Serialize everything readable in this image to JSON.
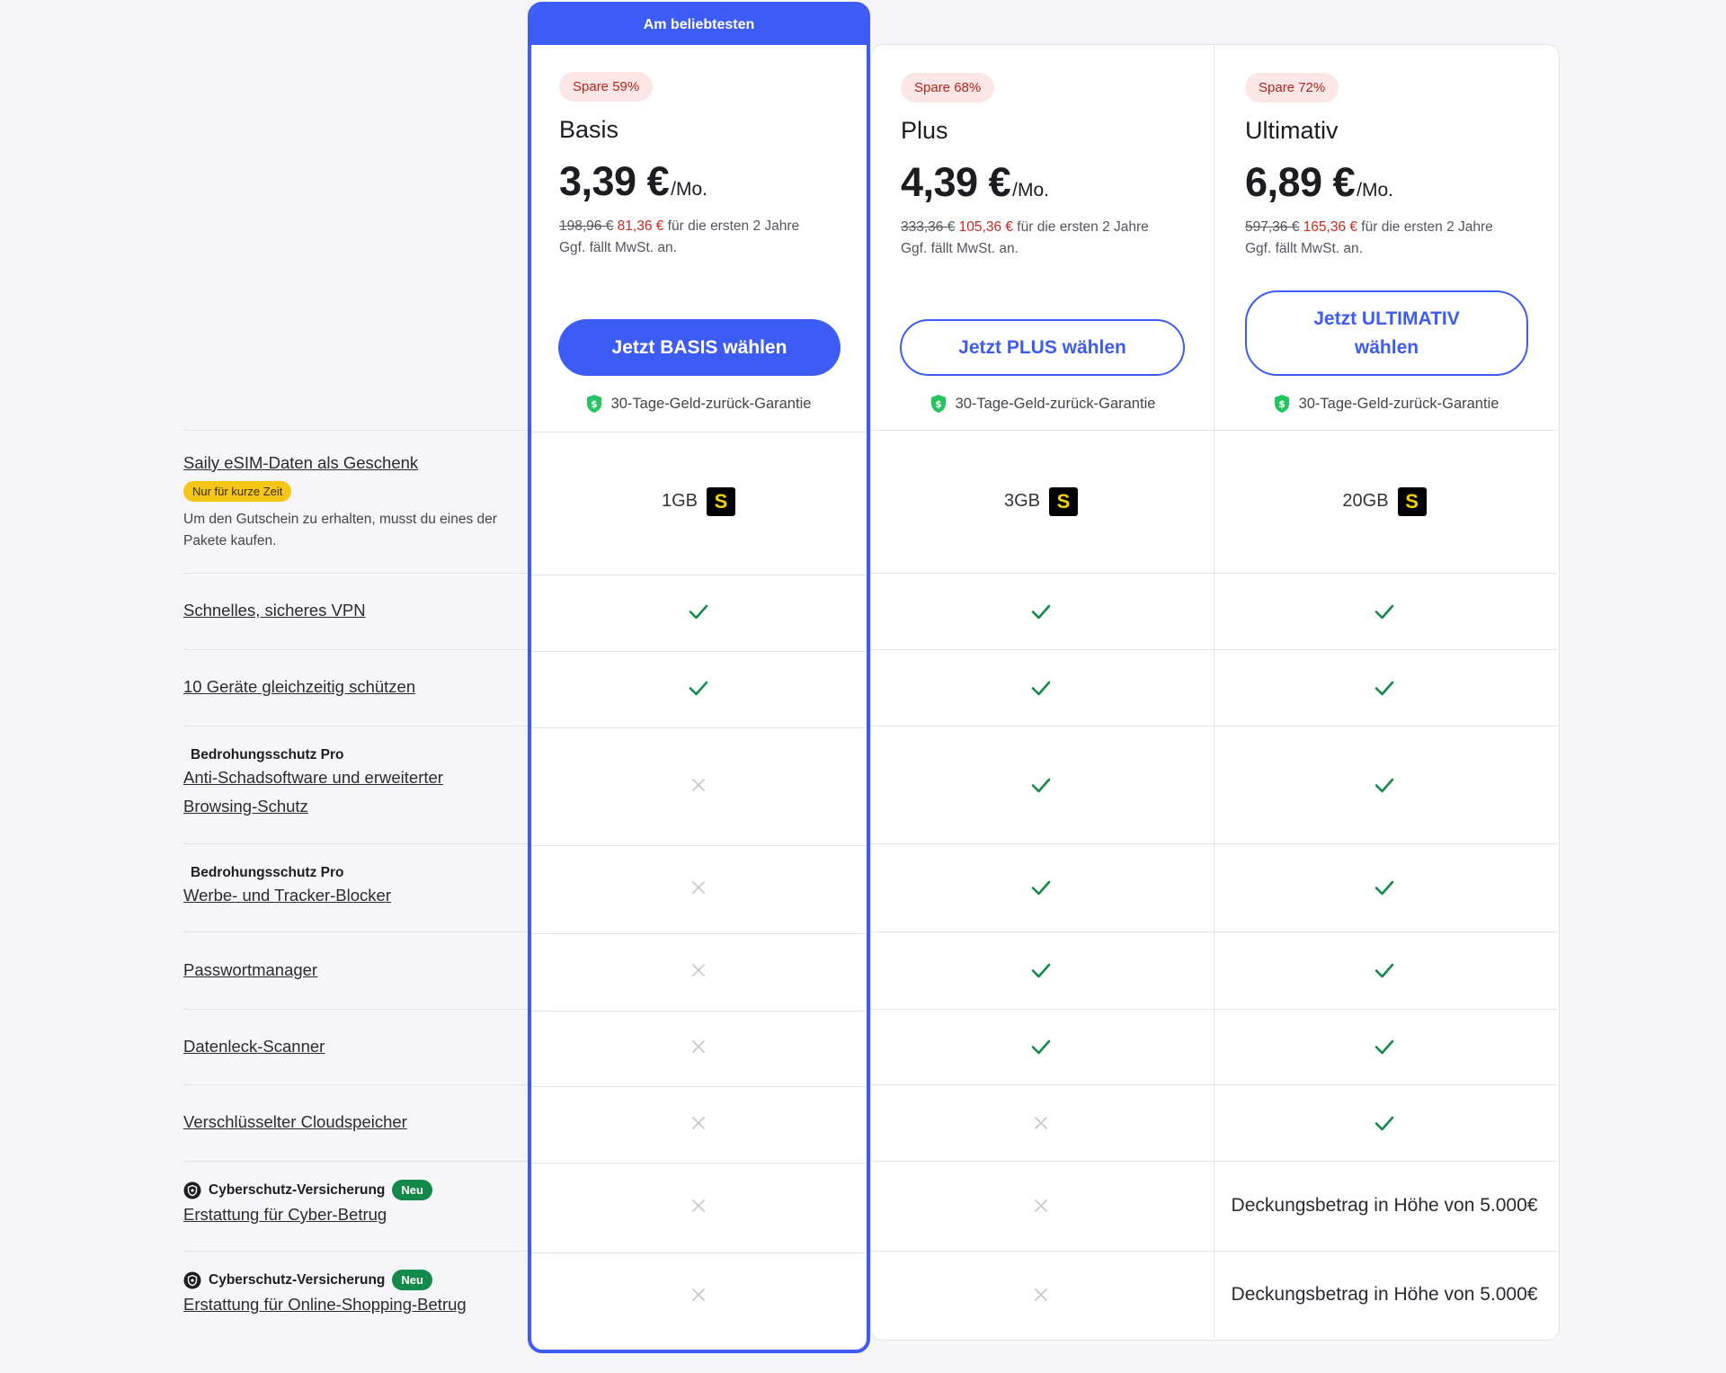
{
  "banner": "Am beliebtesten",
  "plans": [
    {
      "save": "Spare 59%",
      "name": "Basis",
      "price": "3,39 €",
      "unit": "/Mo.",
      "old": "198,96 €",
      "new": "81,36 €",
      "period": " für die ersten 2 Jahre",
      "vat": "Ggf. fällt MwSt. an.",
      "cta": "Jetzt BASIS wählen",
      "guarantee": "30-Tage-Geld-zurück-Garantie",
      "gb": "1GB"
    },
    {
      "save": "Spare 68%",
      "name": "Plus",
      "price": "4,39 €",
      "unit": "/Mo.",
      "old": "333,36 €",
      "new": "105,36 €",
      "period": " für die ersten 2 Jahre",
      "vat": "Ggf. fällt MwSt. an.",
      "cta": "Jetzt PLUS wählen",
      "guarantee": "30-Tage-Geld-zurück-Garantie",
      "gb": "3GB"
    },
    {
      "save": "Spare 72%",
      "name": "Ultimativ",
      "price": "6,89 €",
      "unit": "/Mo.",
      "old": "597,36 €",
      "new": "165,36 €",
      "period": " für die ersten 2 Jahre",
      "vat": "Ggf. fällt MwSt. an.",
      "cta": "Jetzt ULTIMATIV wählen",
      "guarantee": "30-Tage-Geld-zurück-Garantie",
      "gb": "20GB"
    }
  ],
  "saily_glyph": "S",
  "features": {
    "esim": {
      "title": "Saily eSIM-Daten als Geschenk",
      "tag": "Nur für kurze Zeit",
      "note": "Um den Gutschein zu erhalten, musst du eines der Pakete kaufen."
    },
    "vpn": "Schnelles, sicheres VPN",
    "devices": "10 Geräte gleichzeitig schützen",
    "antimalware": {
      "sub": "Bedrohungsschutz Pro",
      "title": "Anti-Schadsoftware und erweiterter Browsing-Schutz"
    },
    "adblock": {
      "sub": "Bedrohungsschutz Pro",
      "title": "Werbe- und Tracker-Blocker"
    },
    "password": "Passwortmanager",
    "leak": "Datenleck-Scanner",
    "cloud": "Verschlüsselter Cloudspeicher",
    "insurance1": {
      "sub": "Cyberschutz-Versicherung",
      "tag": "Neu",
      "title": "Erstattung für Cyber-Betrug"
    },
    "insurance2": {
      "sub": "Cyberschutz-Versicherung",
      "tag": "Neu",
      "title": "Erstattung für Online-Shopping-Betrug"
    }
  },
  "coverage": "Deckungsbetrag in Höhe von 5.000€",
  "colors": {
    "accent": "#3d5cf5",
    "check": "#13894a",
    "cross": "#c9c9cf",
    "sale": "#d3261e",
    "new_tag": "#13894a",
    "limited_tag": "#f5c518"
  }
}
